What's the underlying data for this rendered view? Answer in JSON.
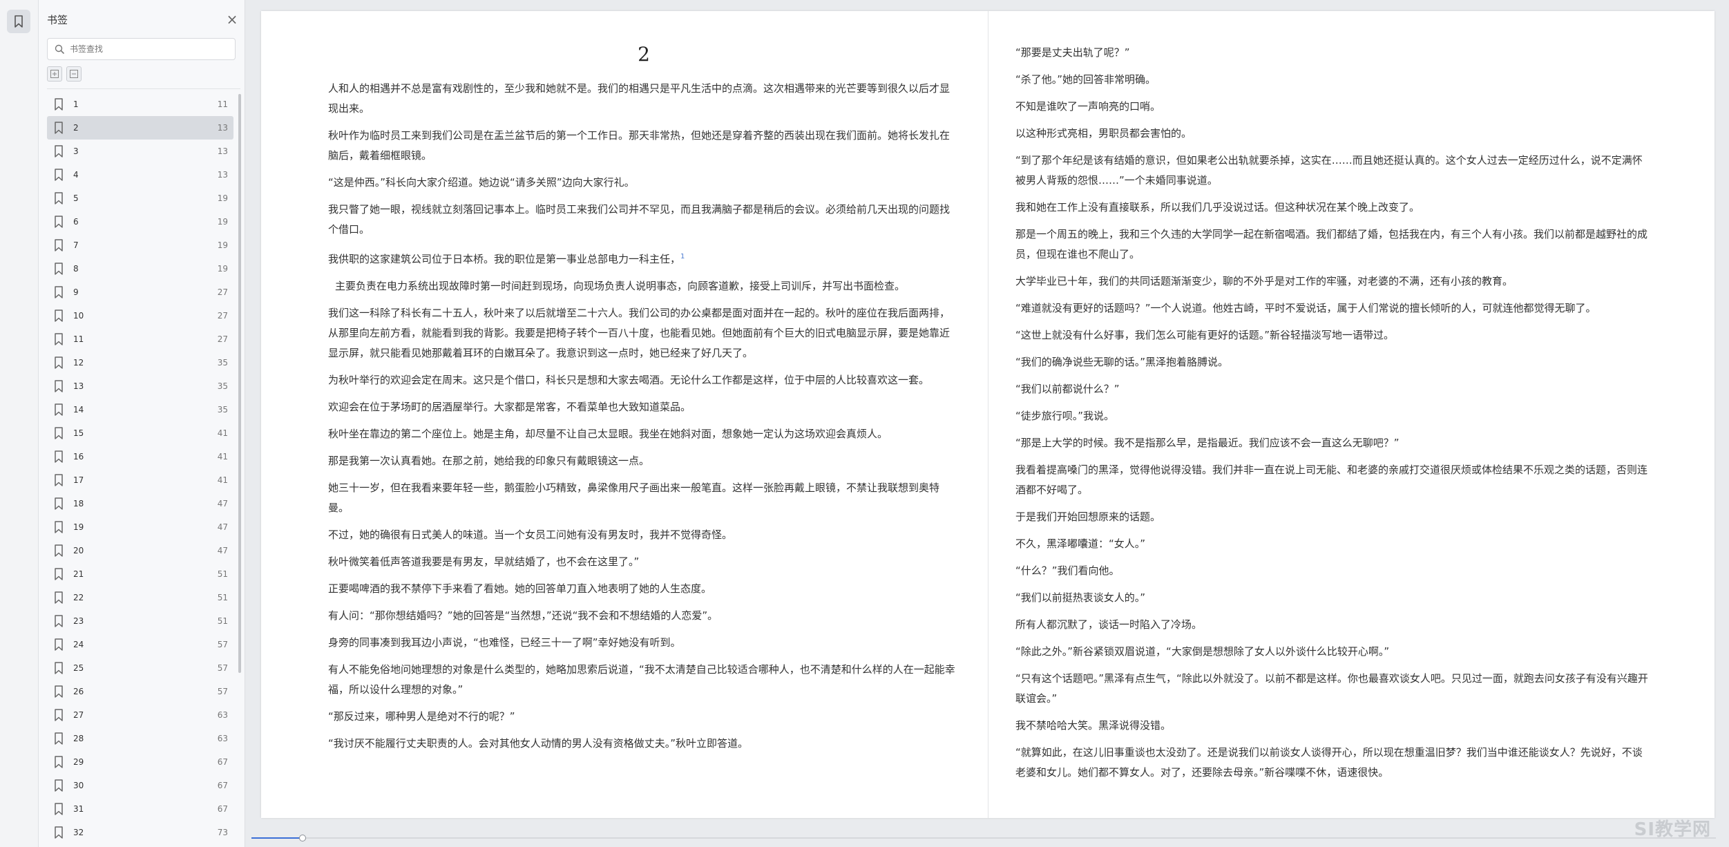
{
  "panel": {
    "title": "书签",
    "search_placeholder": "书签查找",
    "active_index": 1,
    "items": [
      {
        "label": "1",
        "page": "11"
      },
      {
        "label": "2",
        "page": "13"
      },
      {
        "label": "3",
        "page": "13"
      },
      {
        "label": "4",
        "page": "13"
      },
      {
        "label": "5",
        "page": "19"
      },
      {
        "label": "6",
        "page": "19"
      },
      {
        "label": "7",
        "page": "19"
      },
      {
        "label": "8",
        "page": "19"
      },
      {
        "label": "9",
        "page": "27"
      },
      {
        "label": "10",
        "page": "27"
      },
      {
        "label": "11",
        "page": "27"
      },
      {
        "label": "12",
        "page": "35"
      },
      {
        "label": "13",
        "page": "35"
      },
      {
        "label": "14",
        "page": "35"
      },
      {
        "label": "15",
        "page": "41"
      },
      {
        "label": "16",
        "page": "41"
      },
      {
        "label": "17",
        "page": "41"
      },
      {
        "label": "18",
        "page": "47"
      },
      {
        "label": "19",
        "page": "47"
      },
      {
        "label": "20",
        "page": "47"
      },
      {
        "label": "21",
        "page": "51"
      },
      {
        "label": "22",
        "page": "51"
      },
      {
        "label": "23",
        "page": "51"
      },
      {
        "label": "24",
        "page": "57"
      },
      {
        "label": "25",
        "page": "57"
      },
      {
        "label": "26",
        "page": "57"
      },
      {
        "label": "27",
        "page": "63"
      },
      {
        "label": "28",
        "page": "63"
      },
      {
        "label": "29",
        "page": "67"
      },
      {
        "label": "30",
        "page": "67"
      },
      {
        "label": "31",
        "page": "67"
      },
      {
        "label": "32",
        "page": "73"
      }
    ]
  },
  "document": {
    "left_page_number": "2",
    "left_paragraphs": [
      "人和人的相遇并不总是富有戏剧性的，至少我和她就不是。我们的相遇只是平凡生活中的点滴。这次相遇带来的光芒要等到很久以后才显现出来。",
      "秋叶作为临时员工来到我们公司是在盂兰盆节后的第一个工作日。那天非常热，但她还是穿着齐整的西装出现在我们面前。她将长发扎在脑后，戴着细框眼镜。",
      "“这是仲西。”科长向大家介绍道。她边说“请多关照”边向大家行礼。",
      "我只瞥了她一眼，视线就立刻落回记事本上。临时员工来我们公司并不罕见，而且我满脑子都是稍后的会议。必须给前几天出现的问题找个借口。",
      "我供职的这家建筑公司位于日本桥。我的职位是第一事业总部电力一科主任，",
      "主要负责在电力系统出现故障时第一时间赶到现场，向现场负责人说明事态，向顾客道歉，接受上司训斥，并写出书面检查。",
      "我们这一科除了科长有二十五人，秋叶来了以后就增至二十六人。我们公司的办公桌都是面对面并在一起的。秋叶的座位在我后面两排，从那里向左前方看，就能看到我的背影。我要是把椅子转个一百八十度，也能看见她。但她面前有个巨大的旧式电脑显示屏，要是她靠近显示屏，就只能看见她那戴着耳环的白嫩耳朵了。我意识到这一点时，她已经来了好几天了。",
      "为秋叶举行的欢迎会定在周末。这只是个借口，科长只是想和大家去喝酒。无论什么工作都是这样，位于中层的人比较喜欢这一套。",
      "欢迎会在位于茅场町的居酒屋举行。大家都是常客，不看菜单也大致知道菜品。",
      "秋叶坐在靠边的第二个座位上。她是主角，却尽量不让自己太显眼。我坐在她斜对面，想象她一定认为这场欢迎会真烦人。",
      "那是我第一次认真看她。在那之前，她给我的印象只有戴眼镜这一点。",
      "她三十一岁，但在我看来要年轻一些，鹅蛋脸小巧精致，鼻梁像用尺子画出来一般笔直。这样一张脸再戴上眼镜，不禁让我联想到奥特曼。",
      "不过，她的确很有日式美人的味道。当一个女员工问她有没有男友时，我并不觉得奇怪。",
      "秋叶微笑着低声答道我要是有男友，早就结婚了，也不会在这里了。”",
      "正要喝啤酒的我不禁停下手来看了看她。她的回答单刀直入地表明了她的人生态度。",
      "有人问：“那你想结婚吗？”她的回答是“当然想，”还说“我不会和不想结婚的人恋爱”。",
      "身旁的同事凑到我耳边小声说，“也难怪，已经三十一了啊”幸好她没有听到。",
      "有人不能免俗地问她理想的对象是什么类型的，她略加思索后说道，“我不太清楚自己比较适合哪种人，也不清楚和什么样的人在一起能幸福，所以设什么理想的对象。”",
      "“那反过来，哪种男人是绝对不行的呢？”",
      "“我讨厌不能履行丈夫职责的人。会对其他女人动情的男人没有资格做丈夫。”秋叶立即答道。"
    ],
    "right_paragraphs": [
      "“那要是丈夫出轨了呢？”",
      "“杀了他。”她的回答非常明确。",
      "不知是谁吹了一声响亮的口哨。",
      "以这种形式亮相，男职员都会害怕的。",
      "“到了那个年纪是该有结婚的意识，但如果老公出轨就要杀掉，这实在……而且她还挺认真的。这个女人过去一定经历过什么，说不定满怀被男人背叛的怨恨……”一个未婚同事说道。",
      "我和她在工作上没有直接联系，所以我们几乎没说过话。但这种状况在某个晚上改变了。",
      "那是一个周五的晚上，我和三个久违的大学同学一起在新宿喝酒。我们都结了婚，包括我在内，有三个人有小孩。我们以前都是越野社的成员，但现在谁也不爬山了。",
      "大学毕业已十年，我们的共同话题渐渐变少，聊的不外乎是对工作的牢骚，对老婆的不满，还有小孩的教育。",
      "“难道就没有更好的话题吗？”一个人说道。他姓古崎，平时不爱说话，属于人们常说的擅长倾听的人，可就连他都觉得无聊了。",
      "“这世上就没有什么好事，我们怎么可能有更好的话题。”新谷轻描淡写地一语带过。",
      "“我们的确净说些无聊的话。”黑泽抱着胳膊说。",
      "“我们以前都说什么？”",
      "“徒步旅行呗。”我说。",
      "“那是上大学的时候。我不是指那么早，是指最近。我们应该不会一直这么无聊吧？”",
      "我看着提高嗓门的黑泽，觉得他说得没错。我们并非一直在说上司无能、和老婆的亲戚打交道很厌烦或体检结果不乐观之类的话题，否则连酒都不好喝了。",
      "于是我们开始回想原来的话题。",
      "不久，黑泽嘟囔道：“女人。”",
      "“什么？”我们看向他。",
      "“我们以前挺热衷谈女人的。”",
      "所有人都沉默了，谈话一时陷入了冷场。",
      "“除此之外。”新谷紧锁双眉说道，“大家倒是想想除了女人以外谈什么比较开心啊。”",
      "“只有这个话题吧。”黑泽有点生气，“除此以外就没了。以前不都是这样。你也最喜欢谈女人吧。只见过一面，就跑去问女孩子有没有兴趣开联谊会。”",
      "我不禁哈哈大笑。黑泽说得没错。",
      "“就算如此，在这儿旧事重谈也太没劲了。还是说我们以前谈女人谈得开心，所以现在想重温旧梦？我们当中谁还能谈女人？先说好，不谈老婆和女儿。她们都不算女人。对了，还要除去母亲。”新谷喋喋不休，语速很快。"
    ]
  },
  "progress": {
    "fraction": 0.0347
  },
  "watermark": "SI教学网"
}
